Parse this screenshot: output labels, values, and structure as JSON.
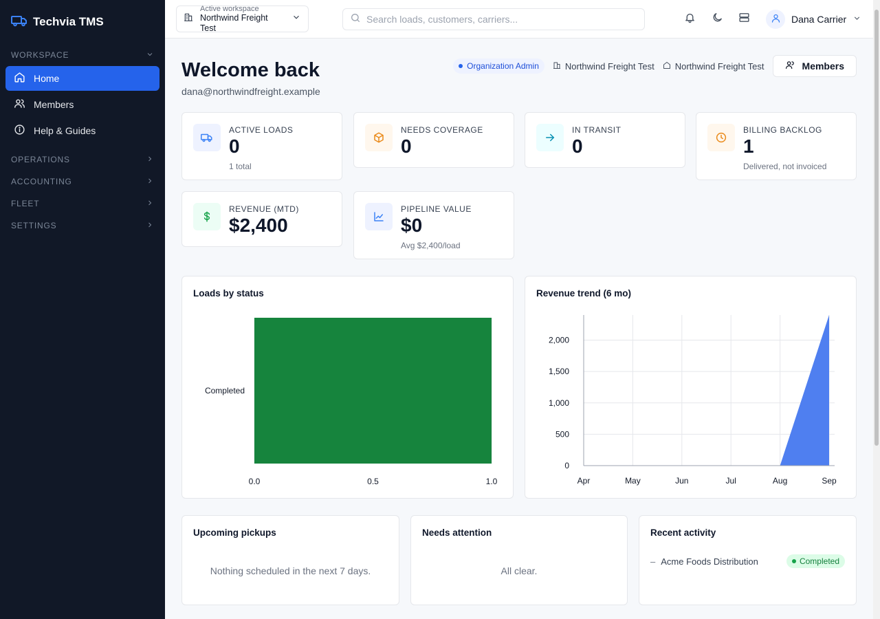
{
  "app": {
    "name": "Techvia TMS"
  },
  "colors": {
    "sidebar_bg": "#111827",
    "accent": "#2563eb",
    "bar_green": "#16843d",
    "area_blue": "#4f7ff0"
  },
  "sidebar": {
    "workspace_section": "WORKSPACE",
    "items": [
      {
        "label": "Home",
        "icon": "home-icon",
        "active": true
      },
      {
        "label": "Members",
        "icon": "users-icon"
      },
      {
        "label": "Help & Guides",
        "icon": "info-icon"
      }
    ],
    "sections": [
      {
        "label": "OPERATIONS"
      },
      {
        "label": "ACCOUNTING"
      },
      {
        "label": "FLEET"
      },
      {
        "label": "SETTINGS"
      }
    ]
  },
  "topbar": {
    "workspace_label": "Active workspace",
    "workspace_name": "Northwind Freight Test",
    "search_placeholder": "Search loads, customers, carriers...",
    "user_name": "Dana Carrier"
  },
  "header": {
    "title": "Welcome back",
    "email": "dana@northwindfreight.example",
    "role": "Organization Admin",
    "org_1": "Northwind Freight Test",
    "org_2": "Northwind Freight Test",
    "members_button": "Members"
  },
  "kpis": [
    {
      "label": "ACTIVE LOADS",
      "value": "0",
      "sub": "1 total"
    },
    {
      "label": "NEEDS COVERAGE",
      "value": "0",
      "sub": ""
    },
    {
      "label": "IN TRANSIT",
      "value": "0",
      "sub": ""
    },
    {
      "label": "BILLING BACKLOG",
      "value": "1",
      "sub": "Delivered, not invoiced"
    },
    {
      "label": "REVENUE (MTD)",
      "value": "$2,400",
      "sub": ""
    },
    {
      "label": "PIPELINE VALUE",
      "value": "$0",
      "sub": "Avg $2,400/load"
    }
  ],
  "panels": {
    "loads_by_status_title": "Loads by status",
    "revenue_trend_title": "Revenue trend (6 mo)",
    "upcoming_title": "Upcoming pickups",
    "upcoming_empty": "Nothing scheduled in the next 7 days.",
    "attention_title": "Needs attention",
    "attention_empty": "All clear.",
    "activity_title": "Recent activity",
    "activity": [
      {
        "name": "Acme Foods Distribution",
        "status": "Completed"
      }
    ]
  },
  "chart_data": [
    {
      "type": "bar",
      "orientation": "horizontal",
      "title": "Loads by status",
      "categories": [
        "Completed"
      ],
      "values": [
        1
      ],
      "xlim": [
        0,
        1
      ],
      "xticks": [
        "0.0",
        "0.5",
        "1.0"
      ],
      "grid": true
    },
    {
      "type": "area",
      "title": "Revenue trend (6 mo)",
      "categories": [
        "Apr",
        "May",
        "Jun",
        "Jul",
        "Aug",
        "Sep"
      ],
      "values": [
        0,
        0,
        0,
        0,
        0,
        2400
      ],
      "ylim": [
        0,
        2400
      ],
      "yticks": [
        "0",
        "500",
        "1,000",
        "1,500",
        "2,000"
      ],
      "grid": true
    }
  ]
}
